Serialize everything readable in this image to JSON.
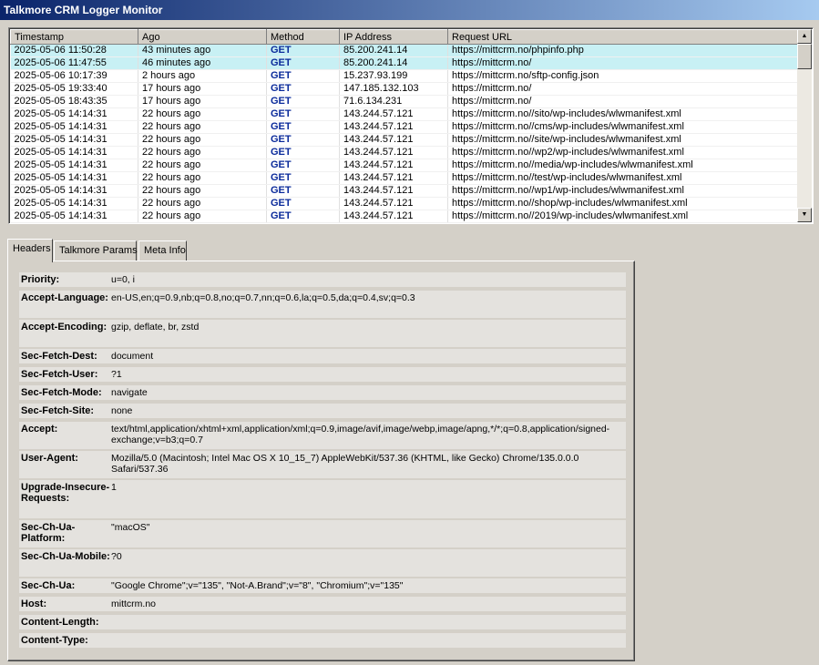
{
  "window": {
    "title": "Talkmore CRM Logger Monitor"
  },
  "log_table": {
    "columns": [
      "Timestamp",
      "Ago",
      "Method",
      "IP Address",
      "Request URL"
    ],
    "rows": [
      {
        "timestamp": "2025-05-06 11:50:28",
        "ago": "43 minutes ago",
        "method": "GET",
        "ip": "85.200.241.14",
        "url": "https://mittcrm.no/phpinfo.php",
        "selected": true
      },
      {
        "timestamp": "2025-05-06 11:47:55",
        "ago": "46 minutes ago",
        "method": "GET",
        "ip": "85.200.241.14",
        "url": "https://mittcrm.no/",
        "selected": true
      },
      {
        "timestamp": "2025-05-06 10:17:39",
        "ago": "2 hours ago",
        "method": "GET",
        "ip": "15.237.93.199",
        "url": "https://mittcrm.no/sftp-config.json",
        "selected": false
      },
      {
        "timestamp": "2025-05-05 19:33:40",
        "ago": "17 hours ago",
        "method": "GET",
        "ip": "147.185.132.103",
        "url": "https://mittcrm.no/",
        "selected": false
      },
      {
        "timestamp": "2025-05-05 18:43:35",
        "ago": "17 hours ago",
        "method": "GET",
        "ip": "71.6.134.231",
        "url": "https://mittcrm.no/",
        "selected": false
      },
      {
        "timestamp": "2025-05-05 14:14:31",
        "ago": "22 hours ago",
        "method": "GET",
        "ip": "143.244.57.121",
        "url": "https://mittcrm.no//sito/wp-includes/wlwmanifest.xml",
        "selected": false
      },
      {
        "timestamp": "2025-05-05 14:14:31",
        "ago": "22 hours ago",
        "method": "GET",
        "ip": "143.244.57.121",
        "url": "https://mittcrm.no//cms/wp-includes/wlwmanifest.xml",
        "selected": false
      },
      {
        "timestamp": "2025-05-05 14:14:31",
        "ago": "22 hours ago",
        "method": "GET",
        "ip": "143.244.57.121",
        "url": "https://mittcrm.no//site/wp-includes/wlwmanifest.xml",
        "selected": false
      },
      {
        "timestamp": "2025-05-05 14:14:31",
        "ago": "22 hours ago",
        "method": "GET",
        "ip": "143.244.57.121",
        "url": "https://mittcrm.no//wp2/wp-includes/wlwmanifest.xml",
        "selected": false
      },
      {
        "timestamp": "2025-05-05 14:14:31",
        "ago": "22 hours ago",
        "method": "GET",
        "ip": "143.244.57.121",
        "url": "https://mittcrm.no//media/wp-includes/wlwmanifest.xml",
        "selected": false
      },
      {
        "timestamp": "2025-05-05 14:14:31",
        "ago": "22 hours ago",
        "method": "GET",
        "ip": "143.244.57.121",
        "url": "https://mittcrm.no//test/wp-includes/wlwmanifest.xml",
        "selected": false
      },
      {
        "timestamp": "2025-05-05 14:14:31",
        "ago": "22 hours ago",
        "method": "GET",
        "ip": "143.244.57.121",
        "url": "https://mittcrm.no//wp1/wp-includes/wlwmanifest.xml",
        "selected": false
      },
      {
        "timestamp": "2025-05-05 14:14:31",
        "ago": "22 hours ago",
        "method": "GET",
        "ip": "143.244.57.121",
        "url": "https://mittcrm.no//shop/wp-includes/wlwmanifest.xml",
        "selected": false
      },
      {
        "timestamp": "2025-05-05 14:14:31",
        "ago": "22 hours ago",
        "method": "GET",
        "ip": "143.244.57.121",
        "url": "https://mittcrm.no//2019/wp-includes/wlwmanifest.xml",
        "selected": false
      }
    ],
    "scroll_up_icon": "triangle-up",
    "scroll_down_icon": "triangle-down"
  },
  "tabs": [
    {
      "label": "Headers",
      "active": true
    },
    {
      "label": "Talkmore Params",
      "active": false
    },
    {
      "label": "Meta Info",
      "active": false
    }
  ],
  "headers": [
    {
      "key": "Priority:",
      "value": "u=0, i"
    },
    {
      "key": "Accept-Language:",
      "value": "en-US,en;q=0.9,nb;q=0.8,no;q=0.7,nn;q=0.6,la;q=0.5,da;q=0.4,sv;q=0.3"
    },
    {
      "key": "Accept-Encoding:",
      "value": "gzip, deflate, br, zstd"
    },
    {
      "key": "Sec-Fetch-Dest:",
      "value": "document"
    },
    {
      "key": "Sec-Fetch-User:",
      "value": "?1"
    },
    {
      "key": "Sec-Fetch-Mode:",
      "value": "navigate"
    },
    {
      "key": "Sec-Fetch-Site:",
      "value": "none"
    },
    {
      "key": "Accept:",
      "value": "text/html,application/xhtml+xml,application/xml;q=0.9,image/avif,image/webp,image/apng,*/*;q=0.8,application/signed-exchange;v=b3;q=0.7"
    },
    {
      "key": "User-Agent:",
      "value": "Mozilla/5.0 (Macintosh; Intel Mac OS X 10_15_7) AppleWebKit/537.36 (KHTML, like Gecko) Chrome/135.0.0.0 Safari/537.36"
    },
    {
      "key": "Upgrade-Insecure-Requests:",
      "value": "1"
    },
    {
      "key": "Sec-Ch-Ua-Platform:",
      "value": "\"macOS\""
    },
    {
      "key": "Sec-Ch-Ua-Mobile:",
      "value": "?0"
    },
    {
      "key": "Sec-Ch-Ua:",
      "value": "\"Google Chrome\";v=\"135\", \"Not-A.Brand\";v=\"8\", \"Chromium\";v=\"135\""
    },
    {
      "key": "Host:",
      "value": "mittcrm.no"
    },
    {
      "key": "Content-Length:",
      "value": ""
    },
    {
      "key": "Content-Type:",
      "value": ""
    }
  ]
}
